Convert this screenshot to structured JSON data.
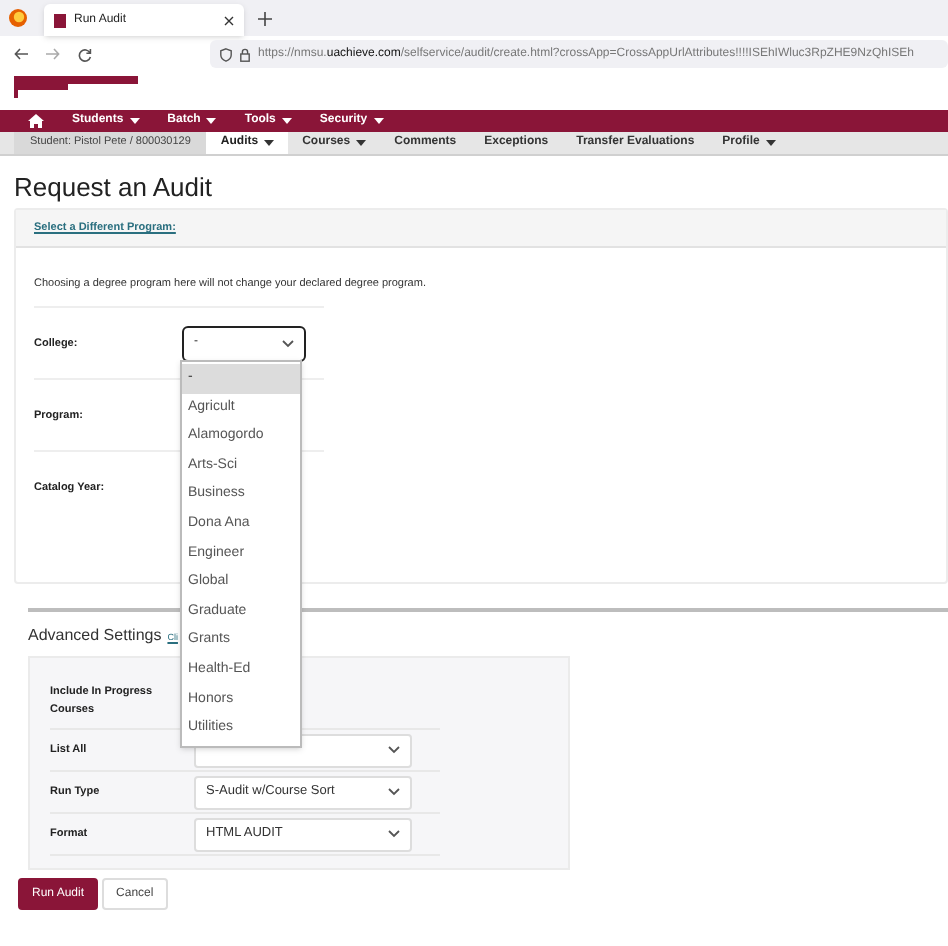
{
  "browser": {
    "tab_title": "Run Audit",
    "url_host": "https://nmsu.",
    "url_domain": "uachieve.com",
    "url_path": "/selfservice/audit/create.html?crossApp=CrossAppUrlAttributes!!!!ISEhIWluc3RpZHE9NzQhISEh"
  },
  "menu": [
    {
      "label": "Students",
      "caret": true
    },
    {
      "label": "Batch",
      "caret": true
    },
    {
      "label": "Tools",
      "caret": true
    },
    {
      "label": "Security",
      "caret": true
    }
  ],
  "student": "Student: Pistol Pete / 800030129",
  "tabs": [
    {
      "label": "Audits",
      "caret": true,
      "selected": true
    },
    {
      "label": "Courses",
      "caret": true,
      "selected": false
    },
    {
      "label": "Comments",
      "caret": false,
      "selected": false
    },
    {
      "label": "Exceptions",
      "caret": false,
      "selected": false
    },
    {
      "label": "Transfer Evaluations",
      "caret": false,
      "selected": false
    },
    {
      "label": "Profile",
      "caret": true,
      "selected": false
    }
  ],
  "heading": "Request an Audit",
  "panel": {
    "link": "Select a Different Program:",
    "note": "Choosing a degree program here will not change your declared degree program.",
    "fields": [
      {
        "label": "College:",
        "kind": "select",
        "value": "-",
        "expanded": true
      },
      {
        "label": "Program:",
        "kind": "hidden"
      },
      {
        "label": "Catalog Year:",
        "kind": "hidden"
      }
    ],
    "options": [
      {
        "label": "-",
        "selected": true
      },
      {
        "label": "Agricult",
        "selected": false
      },
      {
        "label": "Alamogordo",
        "selected": false
      },
      {
        "label": "Arts-Sci",
        "selected": false
      },
      {
        "label": "Business",
        "selected": false
      },
      {
        "label": "Dona Ana",
        "selected": false
      },
      {
        "label": "Engineer",
        "selected": false
      },
      {
        "label": "Global",
        "selected": false
      },
      {
        "label": "Graduate",
        "selected": false
      },
      {
        "label": "Grants",
        "selected": false
      },
      {
        "label": "Health-Ed",
        "selected": false
      },
      {
        "label": "Honors",
        "selected": false
      },
      {
        "label": "Utilities",
        "selected": false
      }
    ]
  },
  "advanced": {
    "title": "Advanced Settings",
    "link": "Cli",
    "settings": [
      {
        "label": "Include In Progress Courses",
        "kind": "hidden"
      },
      {
        "label": "List All",
        "kind": "select"
      },
      {
        "label": "Run Type",
        "kind": "select",
        "value": "S-Audit w/Course Sort"
      },
      {
        "label": "Format",
        "kind": "select",
        "value": "HTML AUDIT"
      }
    ]
  },
  "buttons": [
    {
      "label": "Run Audit",
      "kind": "primary"
    },
    {
      "label": "Cancel",
      "kind": "secondary"
    }
  ]
}
